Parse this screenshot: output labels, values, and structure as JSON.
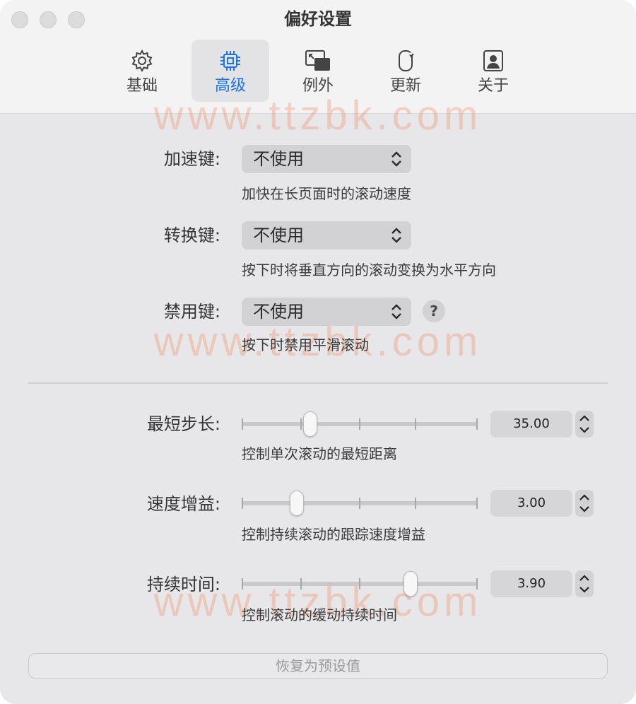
{
  "window": {
    "title": "偏好设置"
  },
  "tabs": [
    {
      "label": "基础",
      "icon": "gear-icon"
    },
    {
      "label": "高级",
      "icon": "chip-icon",
      "active": true
    },
    {
      "label": "例外",
      "icon": "window-overlap-icon"
    },
    {
      "label": "更新",
      "icon": "refresh-icon"
    },
    {
      "label": "关于",
      "icon": "person-card-icon"
    }
  ],
  "keys": [
    {
      "label": "加速键:",
      "value": "不使用",
      "description": "加快在长页面时的滚动速度"
    },
    {
      "label": "转换键:",
      "value": "不使用",
      "description": "按下时将垂直方向的滚动变换为水平方向"
    },
    {
      "label": "禁用键:",
      "value": "不使用",
      "description": "按下时禁用平滑滚动",
      "help": "?"
    }
  ],
  "sliders": [
    {
      "label": "最短步长:",
      "value": "35.00",
      "description": "控制单次滚动的最短距离",
      "level": 0.29
    },
    {
      "label": "速度增益:",
      "value": "3.00",
      "description": "控制持续滚动的跟踪速度增益",
      "level": 0.235
    },
    {
      "label": "持续时间:",
      "value": "3.90",
      "description": "控制滚动的缓动持续时间",
      "level": 0.715
    }
  ],
  "reset_label": "恢复为预设值",
  "watermark": "www.ttzbk.com",
  "colors": {
    "accent": "#1a73e8",
    "watermark": "#f08c64"
  }
}
